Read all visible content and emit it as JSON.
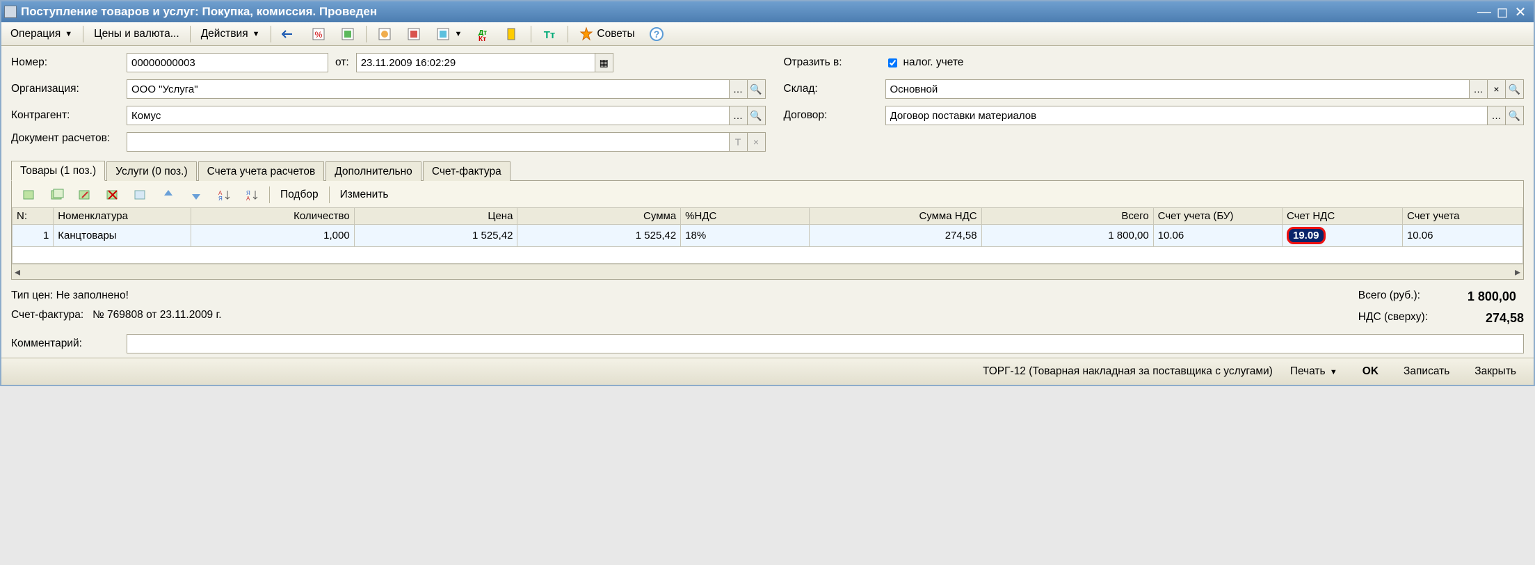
{
  "window": {
    "title": "Поступление товаров и услуг: Покупка, комиссия. Проведен"
  },
  "toolbar": {
    "operation": "Операция",
    "prices": "Цены и валюта...",
    "actions": "Действия",
    "advice": "Советы"
  },
  "form": {
    "number_label": "Номер:",
    "number_value": "00000000003",
    "from_label": "от:",
    "date_value": "23.11.2009 16:02:29",
    "org_label": "Организация:",
    "org_value": "ООО \"Услуга\"",
    "contr_label": "Контрагент:",
    "contr_value": "Комус",
    "docsettle_label": "Документ расчетов:",
    "docsettle_value": "",
    "reflect_label": "Отразить в:",
    "reflect_chk": "налог. учете",
    "sklad_label": "Склад:",
    "sklad_value": "Основной",
    "dogovor_label": "Договор:",
    "dogovor_value": "Договор поставки материалов"
  },
  "tabs": {
    "t0": "Товары (1 поз.)",
    "t1": "Услуги (0 поз.)",
    "t2": "Счета учета расчетов",
    "t3": "Дополнительно",
    "t4": "Счет-фактура"
  },
  "tabtoolbar": {
    "podbor": "Подбор",
    "izmenit": "Изменить"
  },
  "grid": {
    "h_n": "N:",
    "h_nomen": "Номенклатура",
    "h_qty": "Количество",
    "h_price": "Цена",
    "h_sum": "Сумма",
    "h_vatp": "%НДС",
    "h_sumvat": "Сумма НДС",
    "h_total": "Всего",
    "h_acct_bu": "Счет учета (БУ)",
    "h_acct_nds": "Счет НДС",
    "h_acct_last": "Счет учета",
    "rows": [
      {
        "n": "1",
        "nomen": "Канцтовары",
        "qty": "1,000",
        "price": "1 525,42",
        "sum": "1 525,42",
        "vatp": "18%",
        "sumvat": "274,58",
        "total": "1 800,00",
        "acct_bu": "10.06",
        "acct_nds": "19.09",
        "acct_last": "10.06"
      }
    ]
  },
  "footer": {
    "price_type": "Тип цен: Не заполнено!",
    "sf_label": "Счет-фактура:",
    "sf_value": "№ 769808 от 23.11.2009 г.",
    "total_label": "Всего (руб.):",
    "total_value": "1 800,00",
    "vat_label": "НДС (сверху):",
    "vat_value": "274,58",
    "comment_label": "Комментарий:",
    "comment_value": ""
  },
  "status": {
    "doc": "ТОРГ-12 (Товарная накладная за поставщика с услугами)",
    "print": "Печать",
    "ok": "OK",
    "write": "Записать",
    "close": "Закрыть"
  }
}
